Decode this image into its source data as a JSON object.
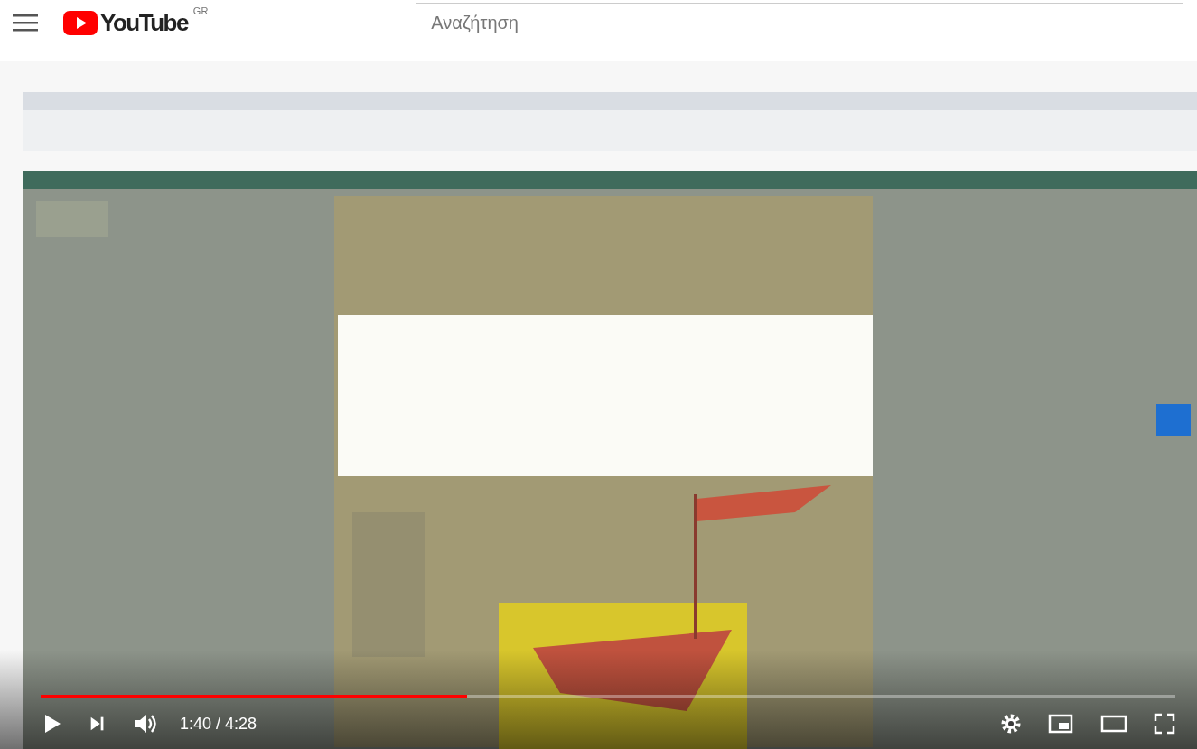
{
  "header": {
    "logo": "YouTube",
    "region": "GR",
    "search": {
      "placeholder": "Αναζήτηση"
    }
  },
  "player": {
    "progress": {
      "level": 0.376
    },
    "time": "1:40 / 4:28"
  }
}
